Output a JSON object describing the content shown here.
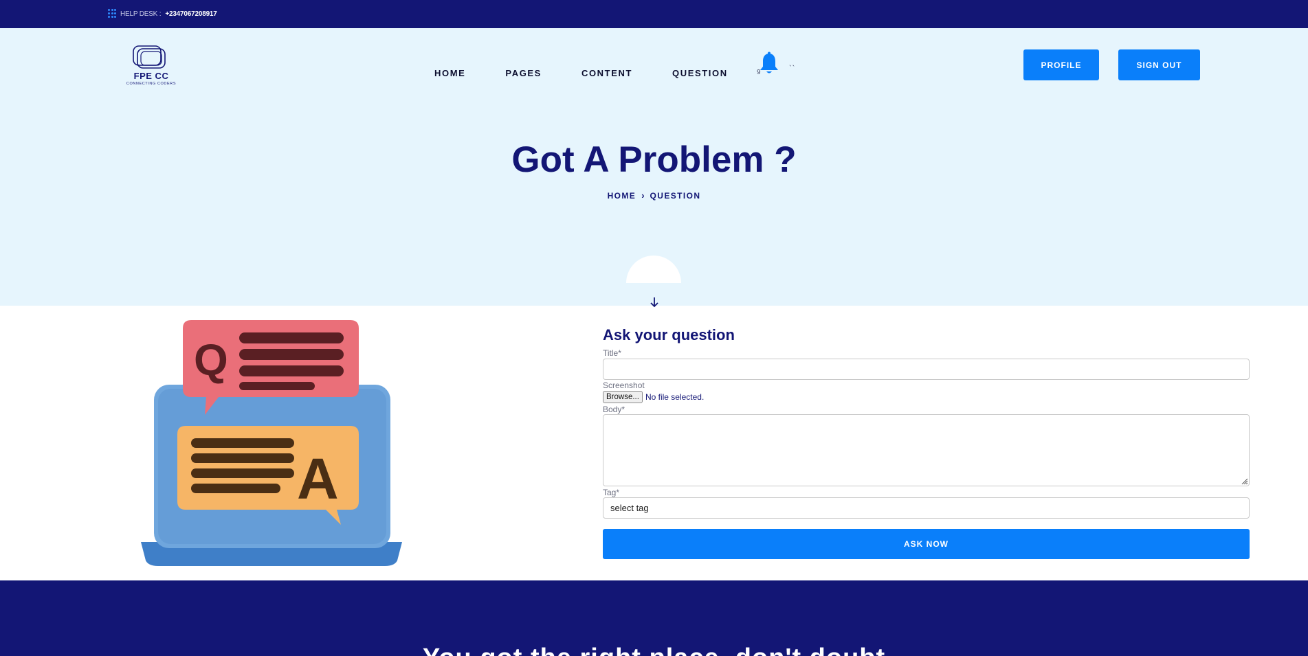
{
  "topbar": {
    "helpdesk_label": "HELP DESK :",
    "helpdesk_number": "+2347067208917",
    "icon": "keypad-icon"
  },
  "logo": {
    "name": "FPE CC",
    "tagline": "CONNECTING CODERS"
  },
  "nav": {
    "items": [
      {
        "label": "HOME"
      },
      {
        "label": "PAGES"
      },
      {
        "label": "CONTENT"
      },
      {
        "label": "QUESTION"
      }
    ],
    "notification_icon": "bell-icon",
    "notification_count": "9",
    "notification_extra": "``"
  },
  "header_buttons": {
    "profile": "PROFILE",
    "sign_out": "SIGN OUT"
  },
  "hero": {
    "title": "Got A Problem ?",
    "breadcrumb": [
      "HOME",
      "QUESTION"
    ],
    "scroll_icon": "arrow-down-icon"
  },
  "form": {
    "heading": "Ask your question",
    "title_label": "Title*",
    "title_value": "",
    "screenshot_label": "Screenshot",
    "browse_label": "Browse...",
    "file_status": "No file selected.",
    "body_label": "Body*",
    "body_value": "",
    "tag_label": "Tag*",
    "tag_value": "select tag",
    "submit_label": "ASK NOW"
  },
  "footer": {
    "partial_text": "You got the right place, don't doubt"
  },
  "colors": {
    "navy": "#131675",
    "accent_blue": "#0a7ffa",
    "hero_bg": "#e6f5fd"
  }
}
